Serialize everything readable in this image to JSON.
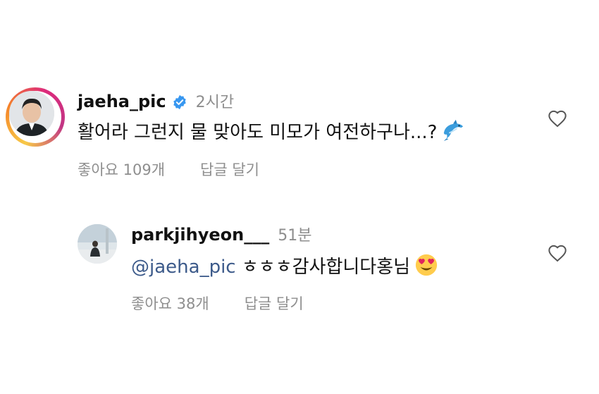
{
  "comments": [
    {
      "username": "jaeha_pic",
      "verified": true,
      "time": "2시간",
      "text": "활어라 그런지 물 맞아도 미모가 여전하구나...?",
      "emoji": "dolphin",
      "likes": "좋아요 109개",
      "reply": "답글 달기"
    },
    {
      "username": "parkjihyeon___",
      "time": "51분",
      "mention": "@jaeha_pic",
      "text": "ㅎㅎㅎ감사합니다홍님",
      "emoji": "heart-eyes",
      "likes": "좋아요 38개",
      "reply": "답글 달기"
    }
  ],
  "icons": {
    "like": "heart-outline-icon",
    "verified": "verified-badge-icon"
  },
  "colors": {
    "verified": "#3797f0",
    "muted": "#8e8e8e",
    "mention": "#3c5a8a"
  }
}
